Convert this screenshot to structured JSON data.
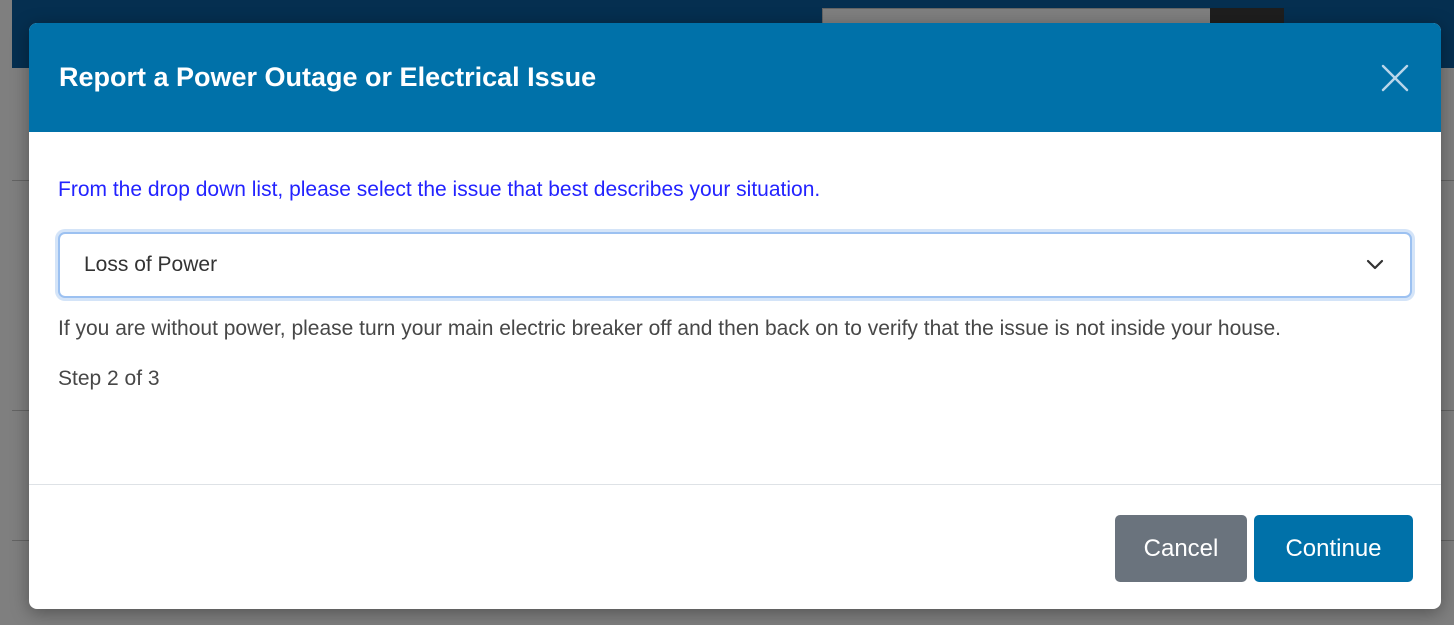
{
  "modal": {
    "title": "Report a Power Outage or Electrical Issue",
    "instruction": "From the drop down list, please select the issue that best describes your situation.",
    "issue_select": {
      "selected": "Loss of Power"
    },
    "help_text": "If you are without power, please turn your main electric breaker off and then back on to verify that the issue is not inside your house.",
    "step_text": "Step 2 of 3",
    "buttons": {
      "cancel": "Cancel",
      "continue": "Continue"
    }
  },
  "colors": {
    "header": "#0071a9",
    "instruction_text": "#2323ff",
    "cancel_button": "#6a737d",
    "continue_button": "#0071a9"
  },
  "icons": {
    "close": "close-icon",
    "dropdown": "chevron-down-icon"
  }
}
